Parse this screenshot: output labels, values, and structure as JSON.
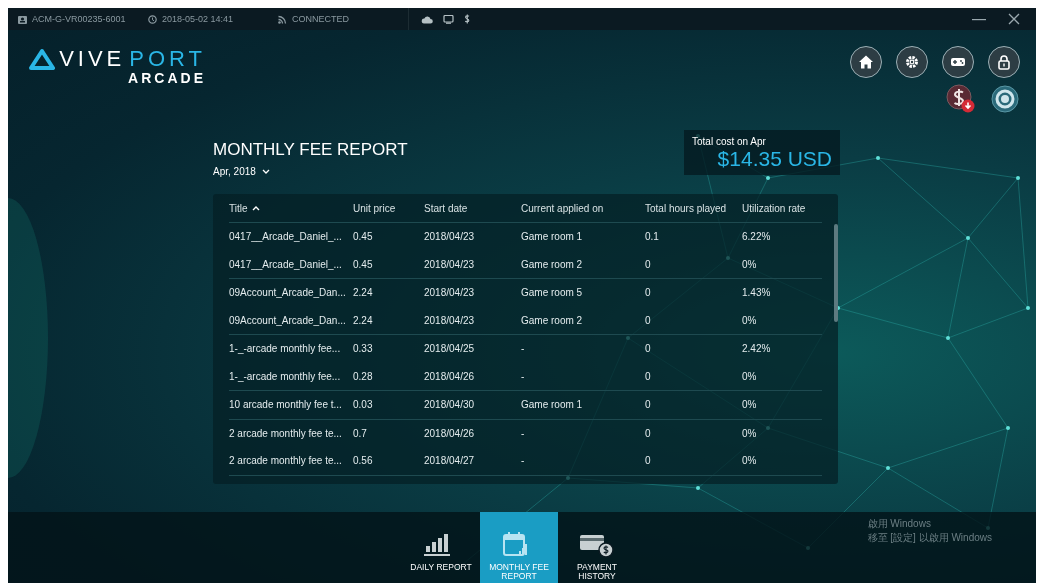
{
  "status_bar": {
    "device_id": "ACM-G-VR00235-6001",
    "datetime": "2018-05-02  14:41",
    "connection": "CONNECTED"
  },
  "logo": {
    "brand_a": "VIVE",
    "brand_b": "PORT",
    "product": "ARCADE"
  },
  "report": {
    "title": "MONTHLY FEE REPORT",
    "month": "Apr, 2018",
    "total_label": "Total cost on Apr",
    "total_value": "$14.35 USD"
  },
  "table": {
    "columns": [
      {
        "label": "Title",
        "sorted": true
      },
      {
        "label": "Unit price",
        "sorted": false
      },
      {
        "label": "Start date",
        "sorted": false
      },
      {
        "label": "Current applied on",
        "sorted": false
      },
      {
        "label": "Total hours played",
        "sorted": false
      },
      {
        "label": "Utilization rate",
        "sorted": false
      }
    ],
    "groups": [
      {
        "rows": [
          [
            "0417__Arcade_Daniel_...",
            "0.45",
            "2018/04/23",
            "Game room 1",
            "0.1",
            "6.22%"
          ],
          [
            "0417__Arcade_Daniel_...",
            "0.45",
            "2018/04/23",
            "Game room 2",
            "0",
            "0%"
          ]
        ]
      },
      {
        "rows": [
          [
            "09Account_Arcade_Dan...",
            "2.24",
            "2018/04/23",
            "Game room 5",
            "0",
            "1.43%"
          ],
          [
            "09Account_Arcade_Dan...",
            "2.24",
            "2018/04/23",
            "Game room 2",
            "0",
            "0%"
          ]
        ]
      },
      {
        "rows": [
          [
            "1-_-arcade monthly fee...",
            "0.33",
            "2018/04/25",
            "-",
            "0",
            "2.42%"
          ],
          [
            "1-_-arcade monthly fee...",
            "0.28",
            "2018/04/26",
            "-",
            "0",
            "0%"
          ]
        ]
      },
      {
        "rows": [
          [
            "10 arcade monthly fee t...",
            "0.03",
            "2018/04/30",
            "Game room 1",
            "0",
            "0%"
          ]
        ]
      },
      {
        "rows": [
          [
            "2 arcade monthly fee te...",
            "0.7",
            "2018/04/26",
            "-",
            "0",
            "0%"
          ],
          [
            "2 arcade monthly fee te...",
            "0.56",
            "2018/04/27",
            "-",
            "0",
            "0%"
          ]
        ]
      }
    ]
  },
  "nav_tabs": [
    {
      "label": "DAILY REPORT",
      "kind": "daily",
      "selected": false
    },
    {
      "label": "MONTHLY FEE REPORT",
      "kind": "monthly",
      "selected": true
    },
    {
      "label": "PAYMENT HISTORY",
      "kind": "payment",
      "selected": false
    }
  ],
  "os_notice": {
    "title": "啟用 Windows",
    "detail": "移至 [設定] 以啟用 Windows"
  }
}
